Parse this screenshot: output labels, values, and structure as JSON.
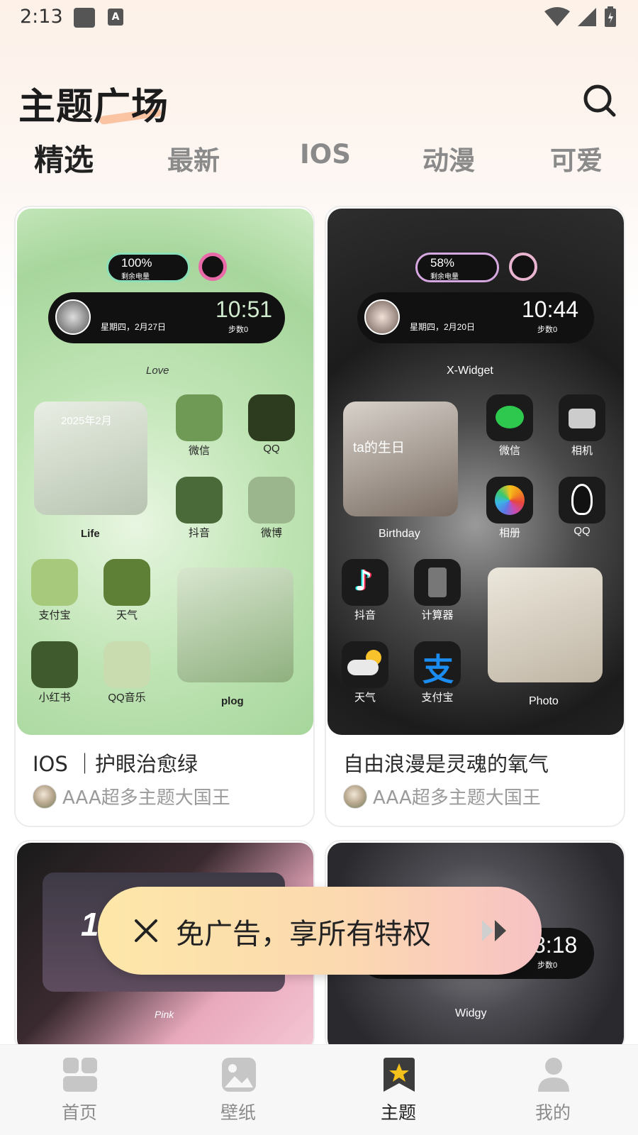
{
  "status_bar": {
    "time": "2:13"
  },
  "header": {
    "title": "主题广场"
  },
  "tabs": [
    {
      "label": "精选",
      "active": true
    },
    {
      "label": "最新",
      "active": false
    },
    {
      "label": "IOS",
      "active": false
    },
    {
      "label": "动漫",
      "active": false
    },
    {
      "label": "可爱",
      "active": false
    }
  ],
  "cards": [
    {
      "title": "IOS ｜护眼治愈绿",
      "author": "AAA超多主题大国王",
      "preview": {
        "battery": "100%",
        "battery_label": "剩余电量",
        "date": "星期四，2月27日",
        "time": "10:51",
        "steps": "步数0",
        "love_text": "Love",
        "calendar_title": "2025年2月",
        "life_label": "Life",
        "plog_label": "plog",
        "apps": [
          "微信",
          "QQ",
          "抖音",
          "微博",
          "支付宝",
          "天气",
          "小红书",
          "QQ音乐"
        ]
      }
    },
    {
      "title": "自由浪漫是灵魂的氧气",
      "author": "AAA超多主题大国王",
      "preview": {
        "battery": "58%",
        "battery_label": "剩余电量",
        "date": "星期四，2月20日",
        "time": "10:44",
        "steps": "步数0",
        "widget_name": "X-Widget",
        "birthday_text": "ta的生日",
        "birthday_label": "Birthday",
        "photo_label": "Photo",
        "apps": [
          "微信",
          "相机",
          "相册",
          "QQ",
          "抖音",
          "计算器",
          "天气",
          "支付宝"
        ]
      }
    },
    {
      "preview": {
        "time_partial": "17",
        "script_text": "Pink"
      }
    },
    {
      "preview": {
        "time": "8:18",
        "steps": "步数0",
        "widget_name": "Widgy"
      }
    }
  ],
  "ad_banner": {
    "text": "免广告，享所有特权"
  },
  "bottom_nav": [
    {
      "label": "首页",
      "icon": "home-icon",
      "active": false
    },
    {
      "label": "壁纸",
      "icon": "wallpaper-icon",
      "active": false
    },
    {
      "label": "主题",
      "icon": "theme-icon",
      "active": true
    },
    {
      "label": "我的",
      "icon": "profile-icon",
      "active": false
    }
  ]
}
